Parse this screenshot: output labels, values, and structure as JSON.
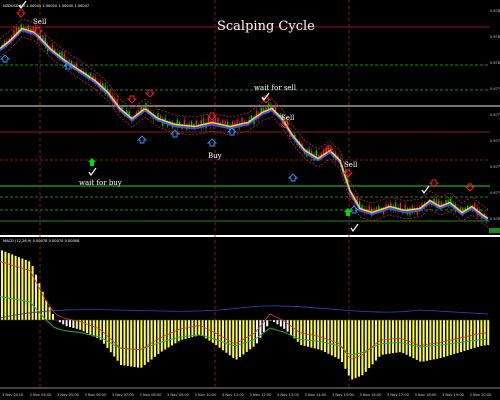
{
  "window": {
    "symbol_info": "NZDUSD,M5  1.00045 1.00050 1.00040 1.00047"
  },
  "annotations": {
    "title": "Scalping Cycle",
    "sell_1": "Sell",
    "wait_for_buy": "wait for buy",
    "buy": "Buy",
    "wait_for_sell": "wait for sell",
    "sell_2": "Sell",
    "sell_3": "Sell"
  },
  "indicator": {
    "label": "MACD (12,26,9)  0.00078  0.00070  0.00008"
  },
  "price_axis": {
    "labels": [
      "0.67840",
      "0.67820",
      "0.67800",
      "0.67780",
      "0.67760",
      "0.67740",
      "0.67720",
      "0.67700",
      "0.67680"
    ]
  },
  "time_axis": {
    "labels": [
      "3 Nov 2016",
      "3 Nov 04:00",
      "3 Nov 05:00",
      "3 Nov 06:00",
      "3 Nov 07:00",
      "3 Nov 08:00",
      "3 Nov 09:00",
      "3 Nov 10:00",
      "3 Nov 11:00",
      "3 Nov 12:00",
      "3 Nov 13:00",
      "3 Nov 14:00",
      "3 Nov 15:00",
      "3 Nov 16:00",
      "3 Nov 17:00",
      "3 Nov 18:00",
      "3 Nov 19:00",
      "3 Nov 20:00"
    ]
  },
  "colors": {
    "background": "#000000",
    "bull_candle": "#00cc00",
    "bear_candle": "#ff2020",
    "ema_fast": "#ffcc33",
    "ema_slow": "#3355ff",
    "band": "#cc2222",
    "level_green": "#1a8a1a",
    "level_red": "#8a1a1a",
    "hist_yellow": "#ffff33",
    "hist_white": "#ffffff",
    "signal_green": "#22aa55",
    "signal_red": "#dd3322",
    "blue_arrow": "#3399ff",
    "annotation_text": "#ffffff"
  },
  "icons": {
    "sell_signal": "red-down-arrow-icon",
    "buy_signal": "blue-up-arrow-icon",
    "check": "white-check-icon",
    "green_up": "green-up-arrow-icon"
  }
}
